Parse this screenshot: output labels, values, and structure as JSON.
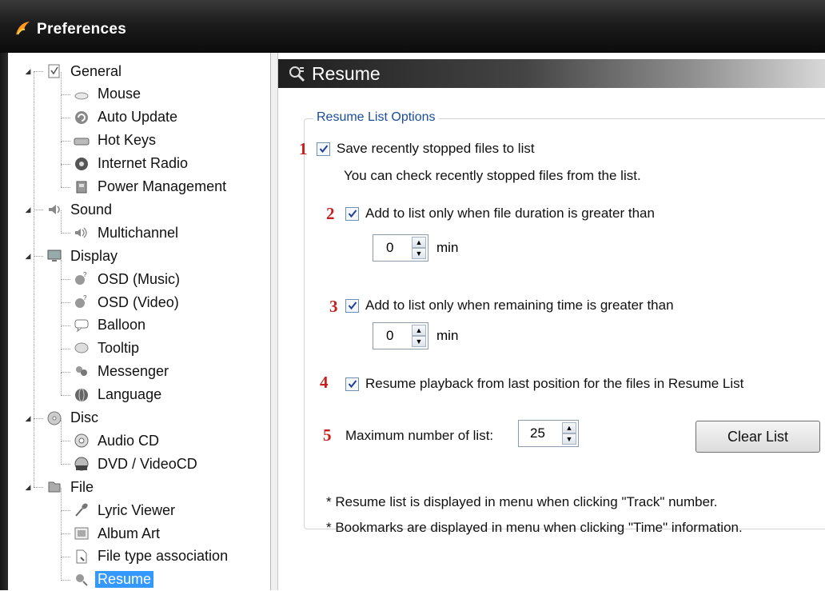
{
  "window": {
    "title": "Preferences"
  },
  "tree": [
    {
      "label": "General",
      "icon": "general-icon",
      "level": 0
    },
    {
      "label": "Mouse",
      "icon": "mouse-icon",
      "level": 1
    },
    {
      "label": "Auto Update",
      "icon": "auto-update-icon",
      "level": 1
    },
    {
      "label": "Hot Keys",
      "icon": "keyboard-icon",
      "level": 1
    },
    {
      "label": "Internet Radio",
      "icon": "radio-icon",
      "level": 1
    },
    {
      "label": "Power Management",
      "icon": "power-icon",
      "level": 1
    },
    {
      "label": "Sound",
      "icon": "sound-icon",
      "level": 0
    },
    {
      "label": "Multichannel",
      "icon": "multichannel-icon",
      "level": 1
    },
    {
      "label": "Display",
      "icon": "display-icon",
      "level": 0
    },
    {
      "label": "OSD (Music)",
      "icon": "osd-icon",
      "level": 1
    },
    {
      "label": "OSD (Video)",
      "icon": "osd-icon",
      "level": 1
    },
    {
      "label": "Balloon",
      "icon": "balloon-icon",
      "level": 1
    },
    {
      "label": "Tooltip",
      "icon": "tooltip-icon",
      "level": 1
    },
    {
      "label": "Messenger",
      "icon": "messenger-icon",
      "level": 1
    },
    {
      "label": "Language",
      "icon": "language-icon",
      "level": 1
    },
    {
      "label": "Disc",
      "icon": "disc-icon",
      "level": 0
    },
    {
      "label": "Audio CD",
      "icon": "audio-cd-icon",
      "level": 1
    },
    {
      "label": "DVD / VideoCD",
      "icon": "dvd-icon",
      "level": 1
    },
    {
      "label": "File",
      "icon": "file-icon",
      "level": 0
    },
    {
      "label": "Lyric Viewer",
      "icon": "microphone-icon",
      "level": 1
    },
    {
      "label": "Album Art",
      "icon": "album-art-icon",
      "level": 1
    },
    {
      "label": "File type association",
      "icon": "file-association-icon",
      "level": 1
    },
    {
      "label": "Resume",
      "icon": "resume-icon",
      "level": 1,
      "selected": true
    }
  ],
  "section": {
    "title": "Resume"
  },
  "group": {
    "title": "Resume List Options"
  },
  "markers": [
    "1",
    "2",
    "3",
    "4",
    "5"
  ],
  "options": {
    "save_recent": {
      "label": "Save recently stopped files to list",
      "checked": true
    },
    "save_recent_desc": "You can check recently stopped files from the list.",
    "duration": {
      "label": "Add to list only when file duration is greater than",
      "checked": true,
      "value": "0",
      "unit": "min"
    },
    "remaining": {
      "label": "Add to list only when remaining time is greater than",
      "checked": true,
      "value": "0",
      "unit": "min"
    },
    "resume_playback": {
      "label": "Resume playback from last position for the files in Resume List",
      "checked": true
    },
    "max_list": {
      "label": "Maximum number of list:",
      "value": "25"
    }
  },
  "buttons": {
    "clear_list": "Clear List"
  },
  "notes": [
    "* Resume list is displayed in menu when clicking \"Track\" number.",
    "* Bookmarks are displayed in menu when clicking \"Time\" information."
  ],
  "colors": {
    "marker": "#c81e1e",
    "group_title": "#1b4c9c",
    "selection": "#3399ff"
  }
}
